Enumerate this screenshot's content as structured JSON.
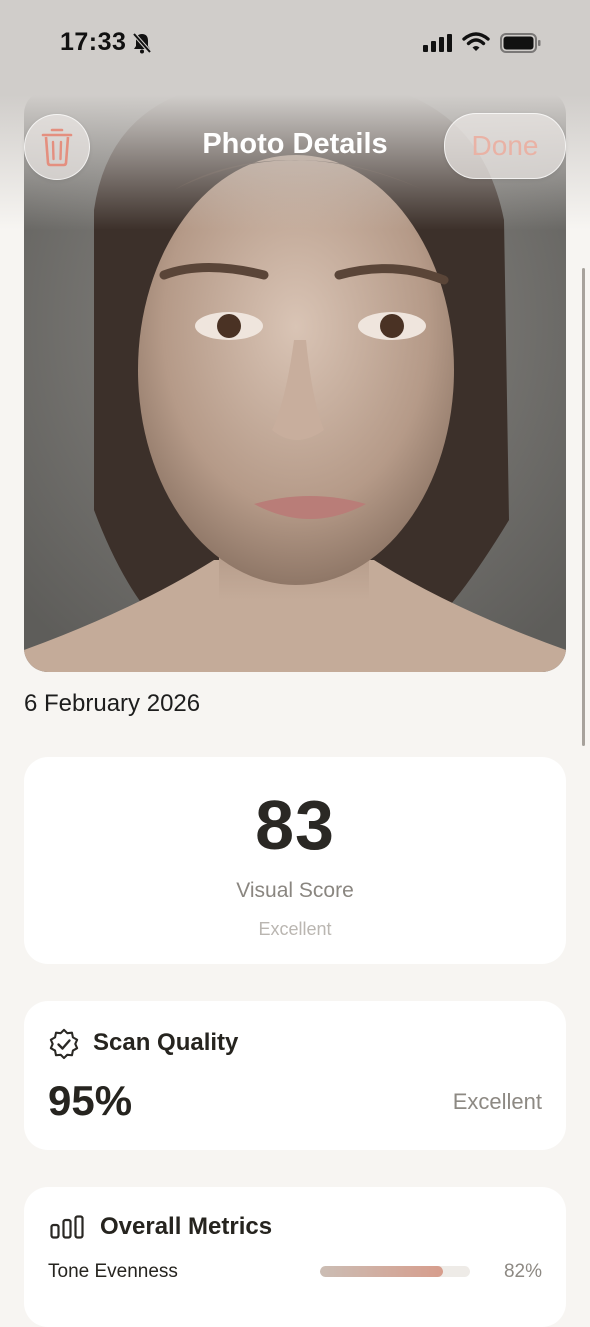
{
  "status": {
    "time": "17:33"
  },
  "nav": {
    "title": "Photo Details",
    "done_label": "Done"
  },
  "photo": {
    "date": "6 February 2026"
  },
  "visual_score": {
    "value": "83",
    "label": "Visual Score",
    "rating": "Excellent"
  },
  "scan_quality": {
    "title": "Scan Quality",
    "value": "95%",
    "rating": "Excellent"
  },
  "overall_metrics": {
    "title": "Overall Metrics",
    "items": [
      {
        "label": "Tone Evenness",
        "value": "82%",
        "fraction": 0.82
      }
    ]
  },
  "colors": {
    "accent": "#e9b2a5",
    "background": "#f7f5f2",
    "card": "#ffffff"
  },
  "icons": [
    "trash-icon",
    "seal-check-icon",
    "bar-chart-icon",
    "bell-slash-icon",
    "signal-icon",
    "wifi-icon",
    "battery-icon"
  ]
}
